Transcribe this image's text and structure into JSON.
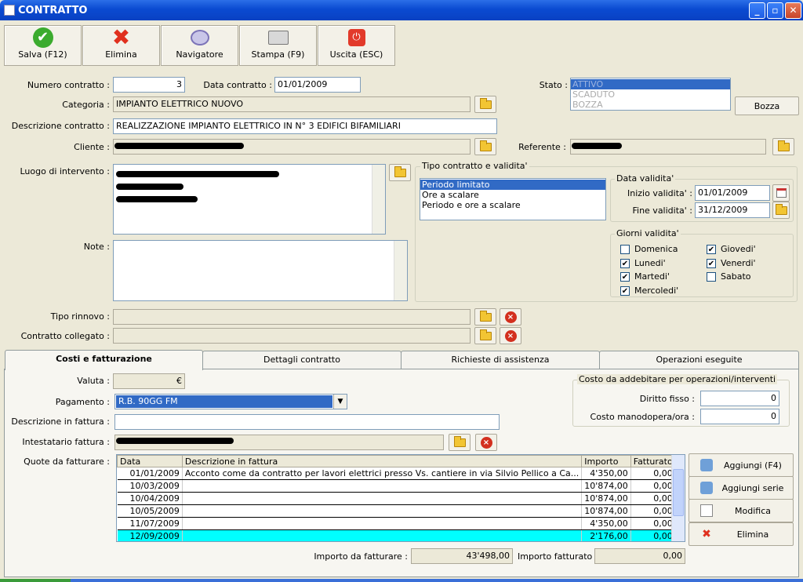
{
  "window": {
    "title": "CONTRATTO",
    "min": "_",
    "max": "▫",
    "close": "✕"
  },
  "toolbar": {
    "save": "Salva (F12)",
    "delete": "Elimina",
    "navigator": "Navigatore",
    "print": "Stampa (F9)",
    "exit": "Uscita (ESC)"
  },
  "form": {
    "numero_label": "Numero contratto :",
    "numero": "3",
    "data_label": "Data contratto :",
    "data": "01/01/2009",
    "stato_label": "Stato :",
    "stato_options": [
      "ATTIVO",
      "SCADUTO",
      "BOZZA"
    ],
    "bozza_button": "Bozza",
    "categoria_label": "Categoria :",
    "categoria": "IMPIANTO ELETTRICO NUOVO",
    "descrizione_label": "Descrizione contratto :",
    "descrizione": "REALIZZAZIONE IMPIANTO ELETTRICO IN N° 3 EDIFICI BIFAMILIARI",
    "cliente_label": "Cliente :",
    "referente_label": "Referente :",
    "luogo_label": "Luogo di intervento :",
    "note_label": "Note :",
    "tipo_rinnovo_label": "Tipo rinnovo :",
    "contratto_collegato_label": "Contratto collegato :"
  },
  "tipo": {
    "group_title": "Tipo contratto e validita'",
    "options": [
      "Periodo limitato",
      "Ore a scalare",
      "Periodo e ore a scalare"
    ],
    "data_group": "Data validita'",
    "inizio_label": "Inizio validita' :",
    "inizio": "01/01/2009",
    "fine_label": "Fine validita' :",
    "fine": "31/12/2009",
    "giorni_group": "Giorni validita'",
    "giorni": [
      {
        "label": "Domenica",
        "checked": false
      },
      {
        "label": "Lunedi'",
        "checked": true
      },
      {
        "label": "Martedi'",
        "checked": true
      },
      {
        "label": "Mercoledi'",
        "checked": true
      },
      {
        "label": "Giovedi'",
        "checked": true
      },
      {
        "label": "Venerdi'",
        "checked": true
      },
      {
        "label": "Sabato",
        "checked": false
      }
    ],
    "check": "✔"
  },
  "tabs": [
    "Costi e fatturazione",
    "Dettagli contratto",
    "Richieste di assistenza",
    "Operazioni eseguite"
  ],
  "costi": {
    "valuta_label": "Valuta :",
    "valuta": "€",
    "pagamento_label": "Pagamento :",
    "pagamento": "R.B.  90GG FM",
    "descr_fattura_label": "Descrizione in fattura :",
    "intestatario_label": "Intestatario fattura :",
    "quote_label": "Quote da fatturare :",
    "group_title": "Costo da addebitare per operazioni/interventi",
    "diritto_label": "Diritto fisso :",
    "diritto": "0",
    "manodopera_label": "Costo manodopera/ora :",
    "manodopera": "0"
  },
  "table": {
    "headers": [
      "Data",
      "Descrizione in fattura",
      "Importo",
      "Fatturato"
    ],
    "rows": [
      [
        "01/01/2009",
        "Acconto come da contratto per lavori elettrici presso Vs. cantiere in via Silvio Pellico a Ca...",
        "4'350,00",
        "0,00"
      ],
      [
        "10/03/2009",
        "",
        "10'874,00",
        "0,00"
      ],
      [
        "10/04/2009",
        "",
        "10'874,00",
        "0,00"
      ],
      [
        "10/05/2009",
        "",
        "10'874,00",
        "0,00"
      ],
      [
        "11/07/2009",
        "",
        "4'350,00",
        "0,00"
      ],
      [
        "12/09/2009",
        "",
        "2'176,00",
        "0,00"
      ]
    ]
  },
  "side_buttons": {
    "aggiungi": "Aggiungi (F4)",
    "aggiungi_serie": "Aggiungi serie",
    "modifica": "Modifica",
    "elimina": "Elimina"
  },
  "totals": {
    "da_fatturare_label": "Importo da fatturare :",
    "da_fatturare": "43'498,00",
    "fatturato_label": "Importo fatturato :",
    "fatturato": "0,00"
  }
}
